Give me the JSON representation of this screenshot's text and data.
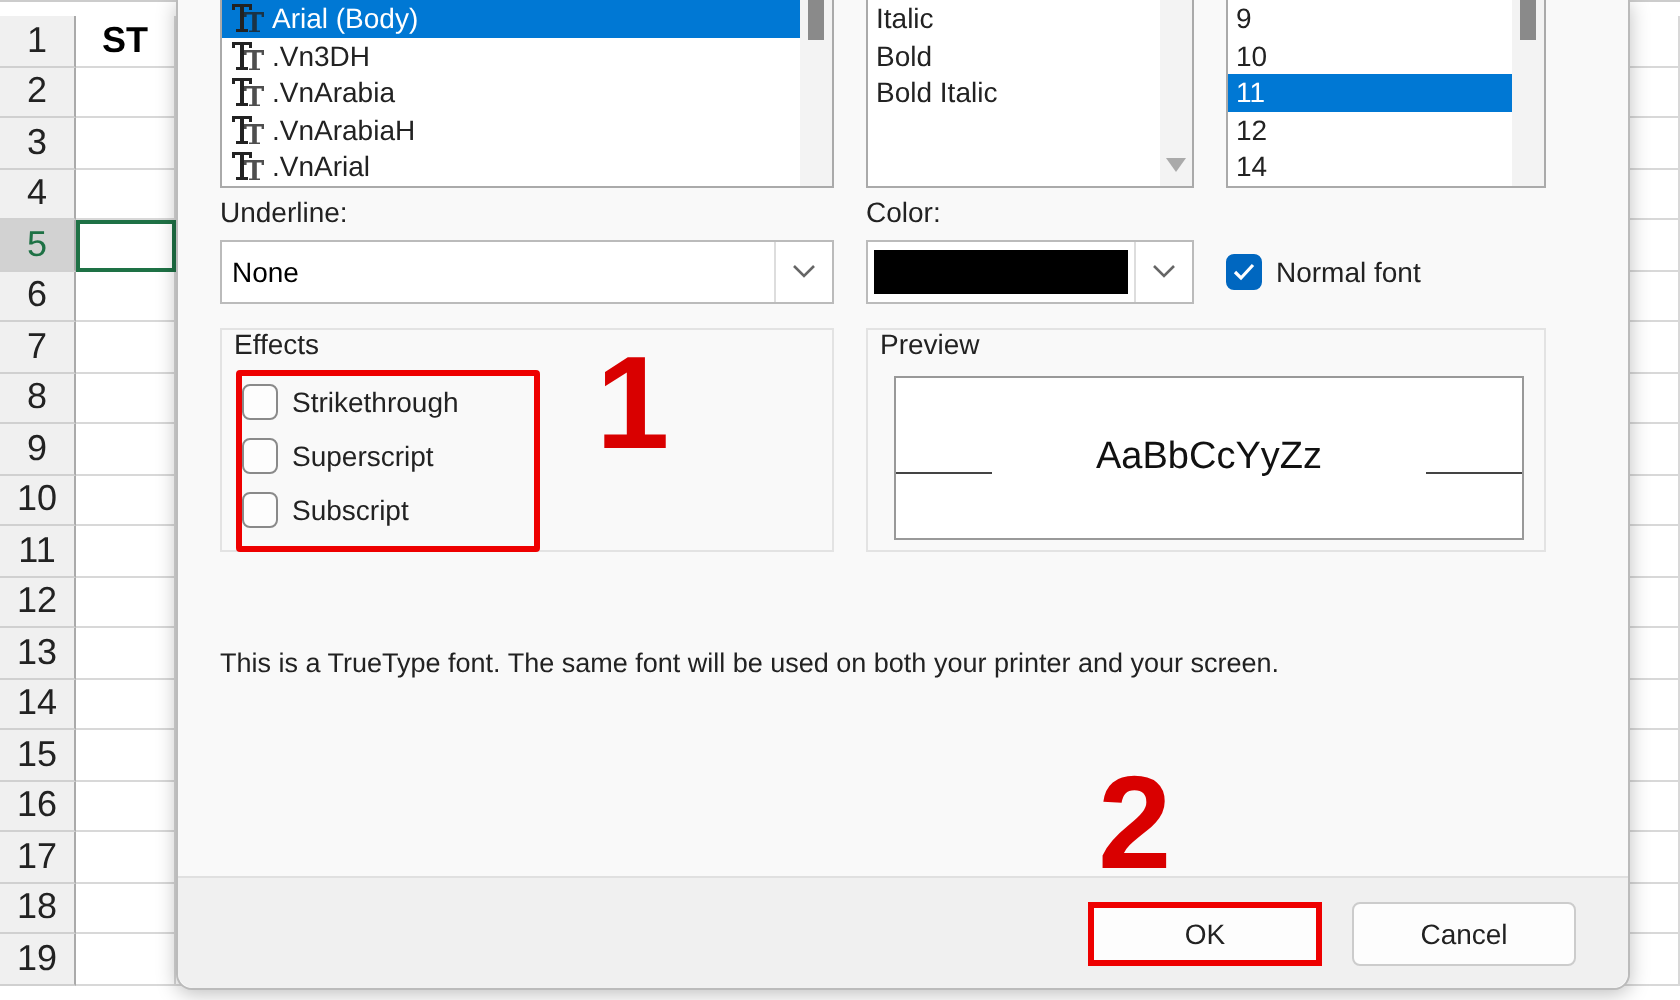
{
  "spreadsheet": {
    "rows": [
      {
        "number": "1",
        "cell": "ST",
        "selected": false
      },
      {
        "number": "2",
        "cell": "",
        "selected": false
      },
      {
        "number": "3",
        "selected": false
      },
      {
        "number": "4",
        "selected": false
      },
      {
        "number": "5",
        "selected": true
      },
      {
        "number": "6",
        "selected": false
      },
      {
        "number": "7",
        "selected": false
      },
      {
        "number": "8",
        "selected": false
      },
      {
        "number": "9",
        "selected": false
      },
      {
        "number": "10",
        "selected": false
      },
      {
        "number": "11",
        "selected": false
      },
      {
        "number": "12",
        "selected": false
      },
      {
        "number": "13",
        "selected": false
      },
      {
        "number": "14",
        "selected": false
      },
      {
        "number": "15",
        "selected": false
      },
      {
        "number": "16",
        "selected": false
      },
      {
        "number": "17",
        "selected": false
      },
      {
        "number": "18",
        "selected": false
      },
      {
        "number": "19",
        "selected": false
      }
    ]
  },
  "dialog": {
    "font_list": [
      {
        "label": "Arial (Body)",
        "selected": true
      },
      {
        "label": ".Vn3DH",
        "selected": false
      },
      {
        "label": ".VnArabia",
        "selected": false
      },
      {
        "label": ".VnArabiaH",
        "selected": false
      },
      {
        "label": ".VnArial",
        "selected": false
      }
    ],
    "style_list": [
      {
        "label": "Italic",
        "selected": false
      },
      {
        "label": "Bold",
        "selected": false
      },
      {
        "label": "Bold Italic",
        "selected": false
      }
    ],
    "size_list": [
      {
        "label": "9",
        "selected": false
      },
      {
        "label": "10",
        "selected": false
      },
      {
        "label": "11",
        "selected": true
      },
      {
        "label": "12",
        "selected": false
      },
      {
        "label": "14",
        "selected": false
      }
    ],
    "underline": {
      "label": "Underline:",
      "value": "None"
    },
    "color": {
      "label": "Color:"
    },
    "normal_font": {
      "label": "Normal font",
      "checked": true
    },
    "effects": {
      "title": "Effects",
      "options": [
        {
          "label": "Strikethrough",
          "checked": false
        },
        {
          "label": "Superscript",
          "checked": false
        },
        {
          "label": "Subscript",
          "checked": false
        }
      ]
    },
    "preview": {
      "title": "Preview",
      "sample": "AaBbCcYyZz"
    },
    "info": "This is a TrueType font.  The same font will be used on both your printer and your screen.",
    "buttons": [
      {
        "label": "OK",
        "highlighted": true
      },
      {
        "label": "Cancel",
        "highlighted": false
      }
    ],
    "annotations": [
      {
        "label": "1"
      },
      {
        "label": "2"
      }
    ]
  }
}
